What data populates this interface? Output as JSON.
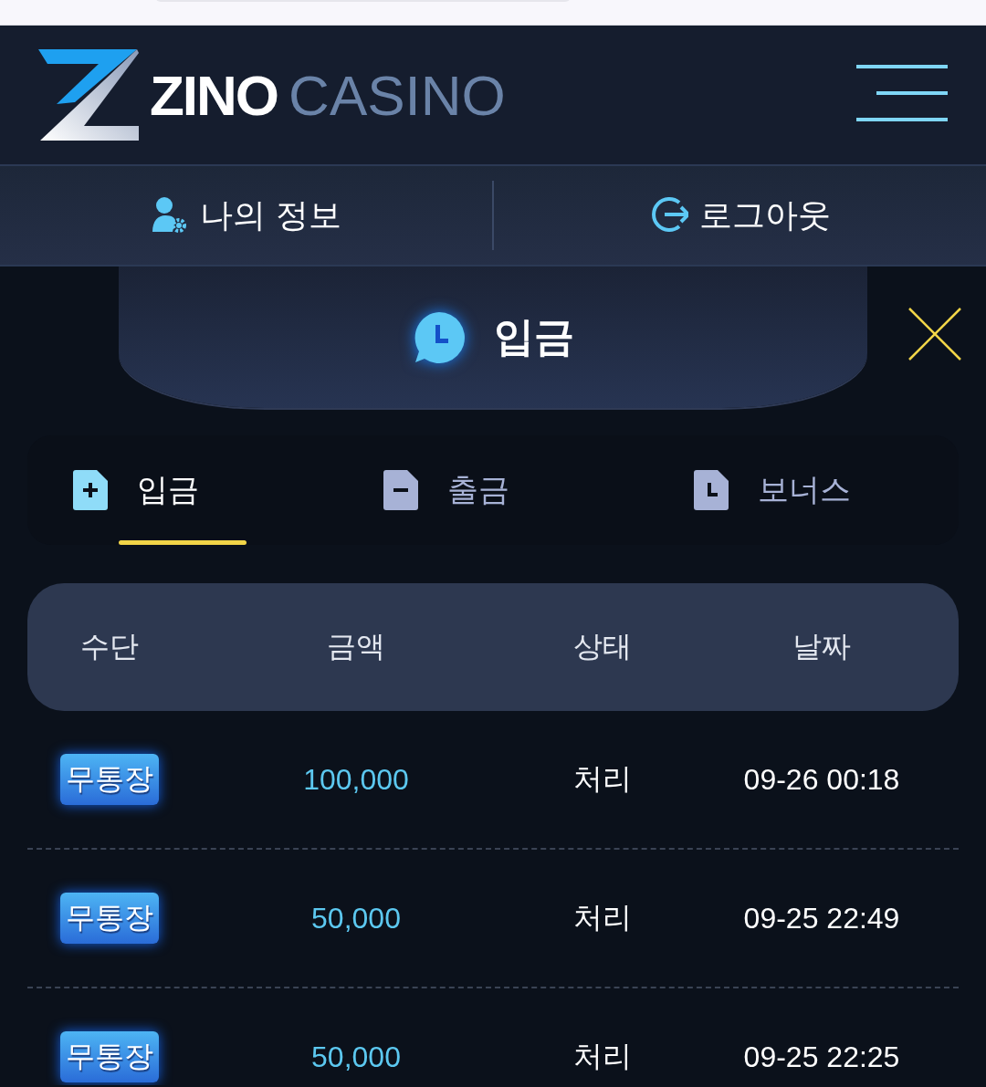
{
  "header": {
    "logo_primary": "ZINO",
    "logo_secondary": "CASINO"
  },
  "nav": [
    {
      "label": "나의 정보"
    },
    {
      "label": "로그아웃"
    }
  ],
  "modal": {
    "title": "입금"
  },
  "tabs": [
    {
      "label": "입금",
      "selected": true
    },
    {
      "label": "출금",
      "selected": false
    },
    {
      "label": "보너스",
      "selected": false
    }
  ],
  "table": {
    "columns": [
      "수단",
      "금액",
      "상태",
      "날짜"
    ],
    "rows": [
      {
        "method": "무통장",
        "amount": "100,000",
        "status": "처리",
        "date": "09-26 00:18"
      },
      {
        "method": "무통장",
        "amount": "50,000",
        "status": "처리",
        "date": "09-25 22:49"
      },
      {
        "method": "무통장",
        "amount": "50,000",
        "status": "처리",
        "date": "09-25 22:25"
      }
    ]
  }
}
